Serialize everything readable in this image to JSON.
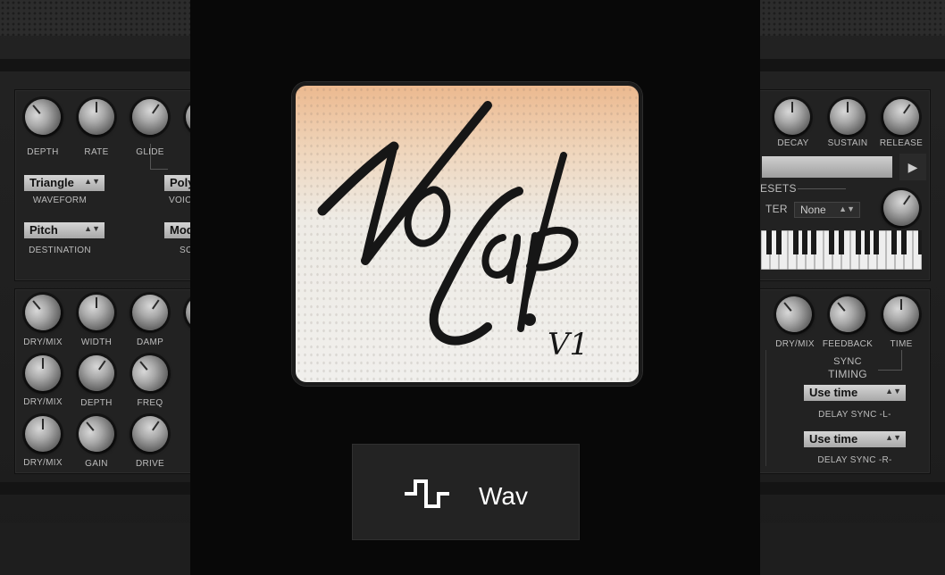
{
  "left_panel": {
    "lfo": {
      "knobs": [
        "DEPTH",
        "RATE",
        "GLIDE"
      ],
      "waveform": {
        "value": "Triangle",
        "label": "WAVEFORM"
      },
      "destination": {
        "value": "Pitch",
        "label": "DESTINATION"
      },
      "voice": {
        "value": "Poly",
        "label": "VOIC"
      },
      "source": {
        "value": "Mod",
        "label": "SC"
      }
    },
    "fx": {
      "row1": [
        "DRY/MIX",
        "WIDTH",
        "DAMP"
      ],
      "row2": [
        "DRY/MIX",
        "DEPTH",
        "FREQ"
      ],
      "row3": [
        "DRY/MIX",
        "GAIN",
        "DRIVE"
      ]
    }
  },
  "right_panel": {
    "envelope_knobs": [
      "DECAY",
      "SUSTAIN",
      "RELEASE"
    ],
    "presets_label": "ESETS",
    "filter_label": "TER",
    "filter_select": "None",
    "delay_knobs": [
      "DRY/MIX",
      "FEEDBACK",
      "TIME"
    ],
    "sync_label_1": "SYNC",
    "sync_label_2": "TIMING",
    "delay_left": {
      "value": "Use time",
      "label": "DELAY SYNC -L-"
    },
    "delay_right": {
      "value": "Use time",
      "label": "DELAY SYNC -R-"
    }
  },
  "product": {
    "logo_text_main": "NoCap!",
    "logo_version": "V1",
    "format_label": "Wav",
    "format_icon": "square-wave-icon"
  },
  "colors": {
    "center_bg": "#080808",
    "tile_bg": "#232323",
    "logo_top": "#ecb98f",
    "logo_bottom": "#f0efec"
  }
}
